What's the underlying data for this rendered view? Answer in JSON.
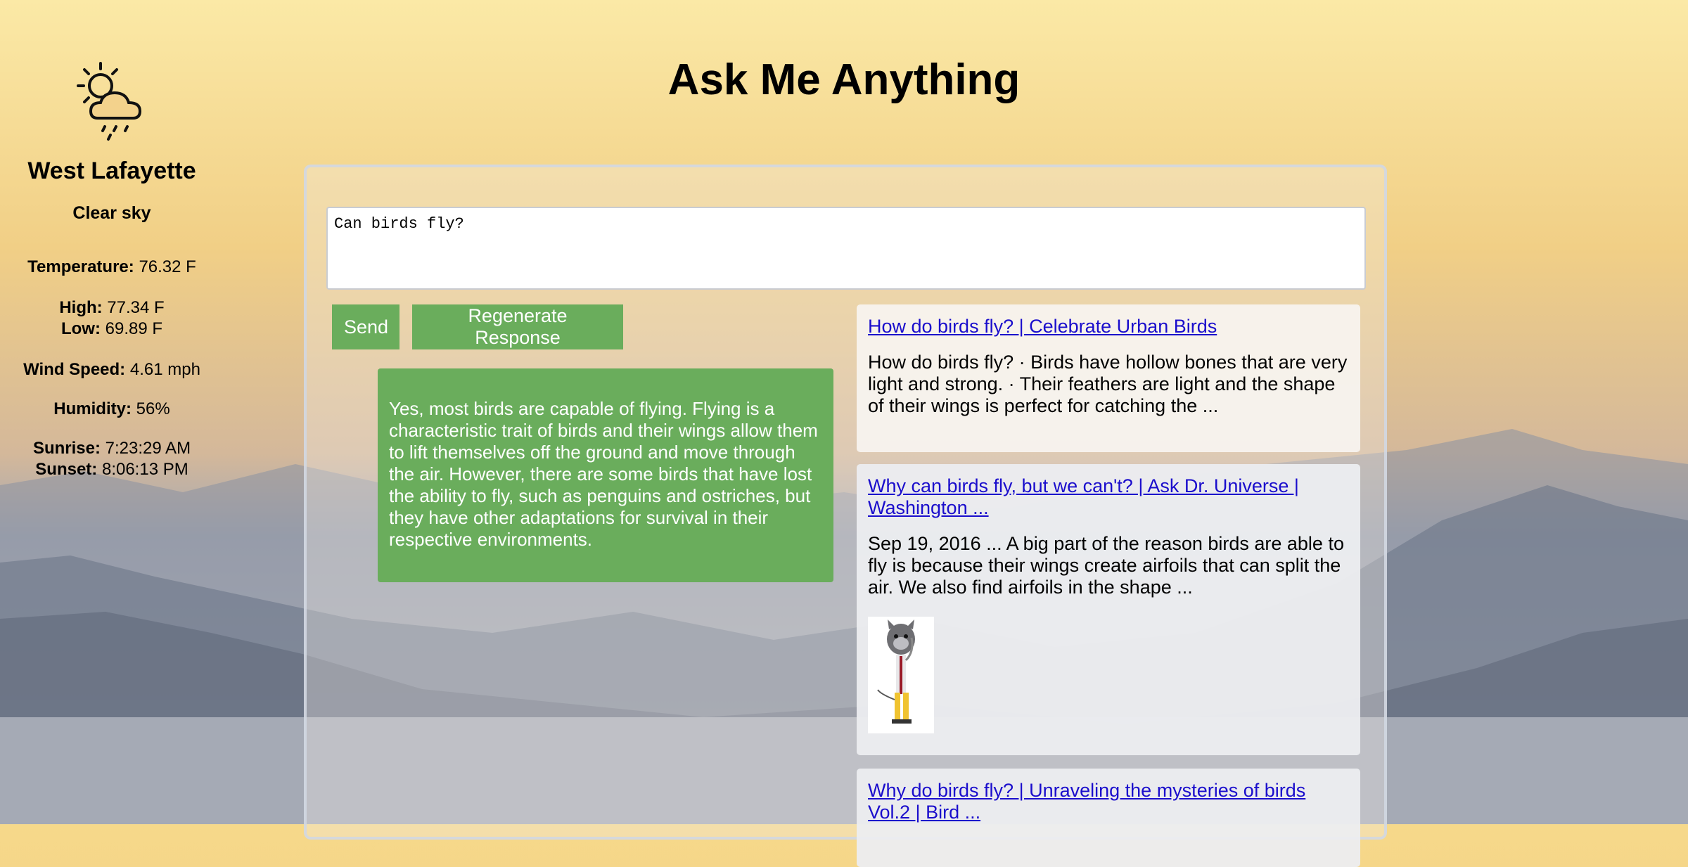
{
  "weather": {
    "icon": "partly-cloudy-rain-icon",
    "city": "West Lafayette",
    "description": "Clear sky",
    "temperature_label": "Temperature:",
    "temperature": "76.32 F",
    "high_label": "High:",
    "high": "77.34 F",
    "low_label": "Low:",
    "low": "69.89 F",
    "wind_label": "Wind Speed:",
    "wind": "4.61 mph",
    "humidity_label": "Humidity:",
    "humidity": "56%",
    "sunrise_label": "Sunrise:",
    "sunrise": "7:23:29 AM",
    "sunset_label": "Sunset:",
    "sunset": "8:06:13 PM"
  },
  "page": {
    "title": "Ask Me Anything"
  },
  "query": {
    "value": "Can birds fly?"
  },
  "buttons": {
    "send": "Send",
    "regenerate": "Regenerate Response"
  },
  "answer": {
    "text": "Yes, most birds are capable of flying. Flying is a characteristic trait of birds and their wings allow them to lift themselves off the ground and move through the air. However, there are some birds that have lost the ability to fly, such as penguins and ostriches, but they have other adaptations for survival in their respective environments."
  },
  "results": [
    {
      "title": "How do birds fly? | Celebrate Urban Birds",
      "snippet": "How do birds fly? · Birds have hollow bones that are very light and strong. · Their feathers are light and the shape of their wings is perfect for catching the ..."
    },
    {
      "title": "Why can birds fly, but we can't? | Ask Dr. Universe | Washington ...",
      "snippet": "Sep 19, 2016 ... A big part of the reason birds are able to fly is because their wings create airfoils that can split the air. We also find airfoils in the shape ..."
    },
    {
      "title": "Why do birds fly? | Unraveling the mysteries of birds Vol.2 | Bird ..."
    }
  ],
  "colors": {
    "accent": "#6aad5c",
    "link": "#1a0dcc"
  }
}
